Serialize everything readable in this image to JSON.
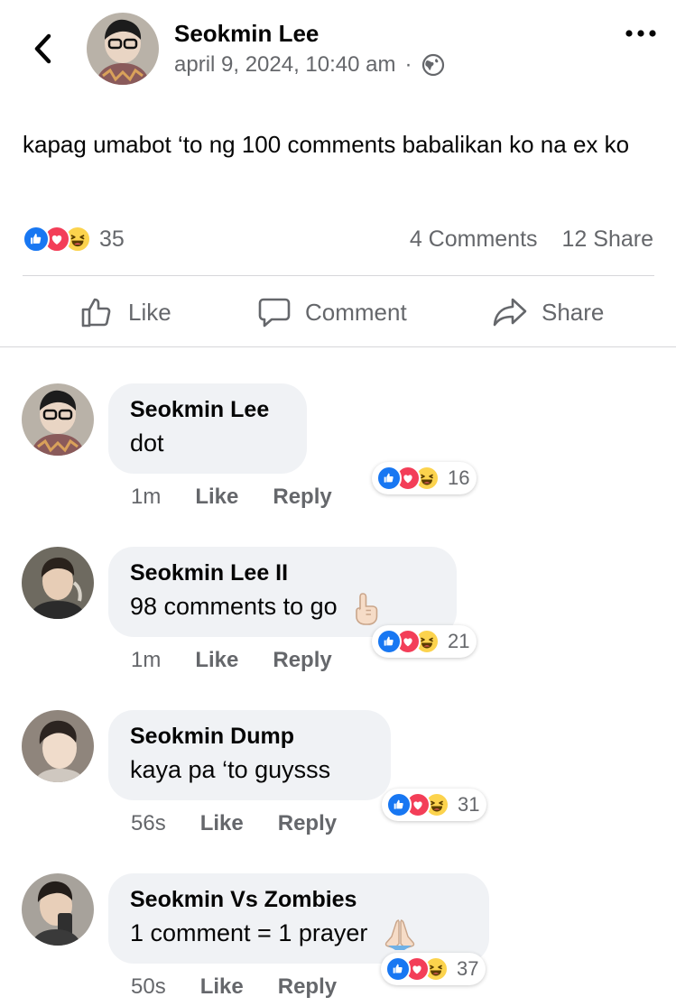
{
  "post": {
    "author": "Seokmin Lee",
    "timestamp": "april 9, 2024, 10:40 am",
    "separator": "·",
    "privacy_icon": "globe-icon",
    "text": "kapag umabot ‘to ng 100 comments babalikan ko na ex ko",
    "reaction_icons": [
      "like",
      "love",
      "haha"
    ],
    "reaction_count": "35",
    "comments_count": "4 Comments",
    "share_count": "12 Share"
  },
  "actions": {
    "like": "Like",
    "comment": "Comment",
    "share": "Share"
  },
  "comments": [
    {
      "name": "Seokmin Lee",
      "text": "dot",
      "emoji": "",
      "time": "1m",
      "like": "Like",
      "reply": "Reply",
      "reactions": "16"
    },
    {
      "name": "Seokmin Lee II",
      "text": "98 comments to go",
      "emoji": "pointing-up-emoji",
      "time": "1m",
      "like": "Like",
      "reply": "Reply",
      "reactions": "21"
    },
    {
      "name": "Seokmin Dump",
      "text": "kaya pa ‘to guysss",
      "emoji": "",
      "time": "56s",
      "like": "Like",
      "reply": "Reply",
      "reactions": "31"
    },
    {
      "name": "Seokmin Vs Zombies",
      "text": "1 comment = 1 prayer",
      "emoji": "folded-hands-emoji",
      "time": "50s",
      "like": "Like",
      "reply": "Reply",
      "reactions": "37"
    }
  ],
  "colors": {
    "like": "#1877f2",
    "love": "#f33e58",
    "haha": "#fcd34d",
    "muted": "#65676b",
    "bubble": "#f0f2f5"
  }
}
